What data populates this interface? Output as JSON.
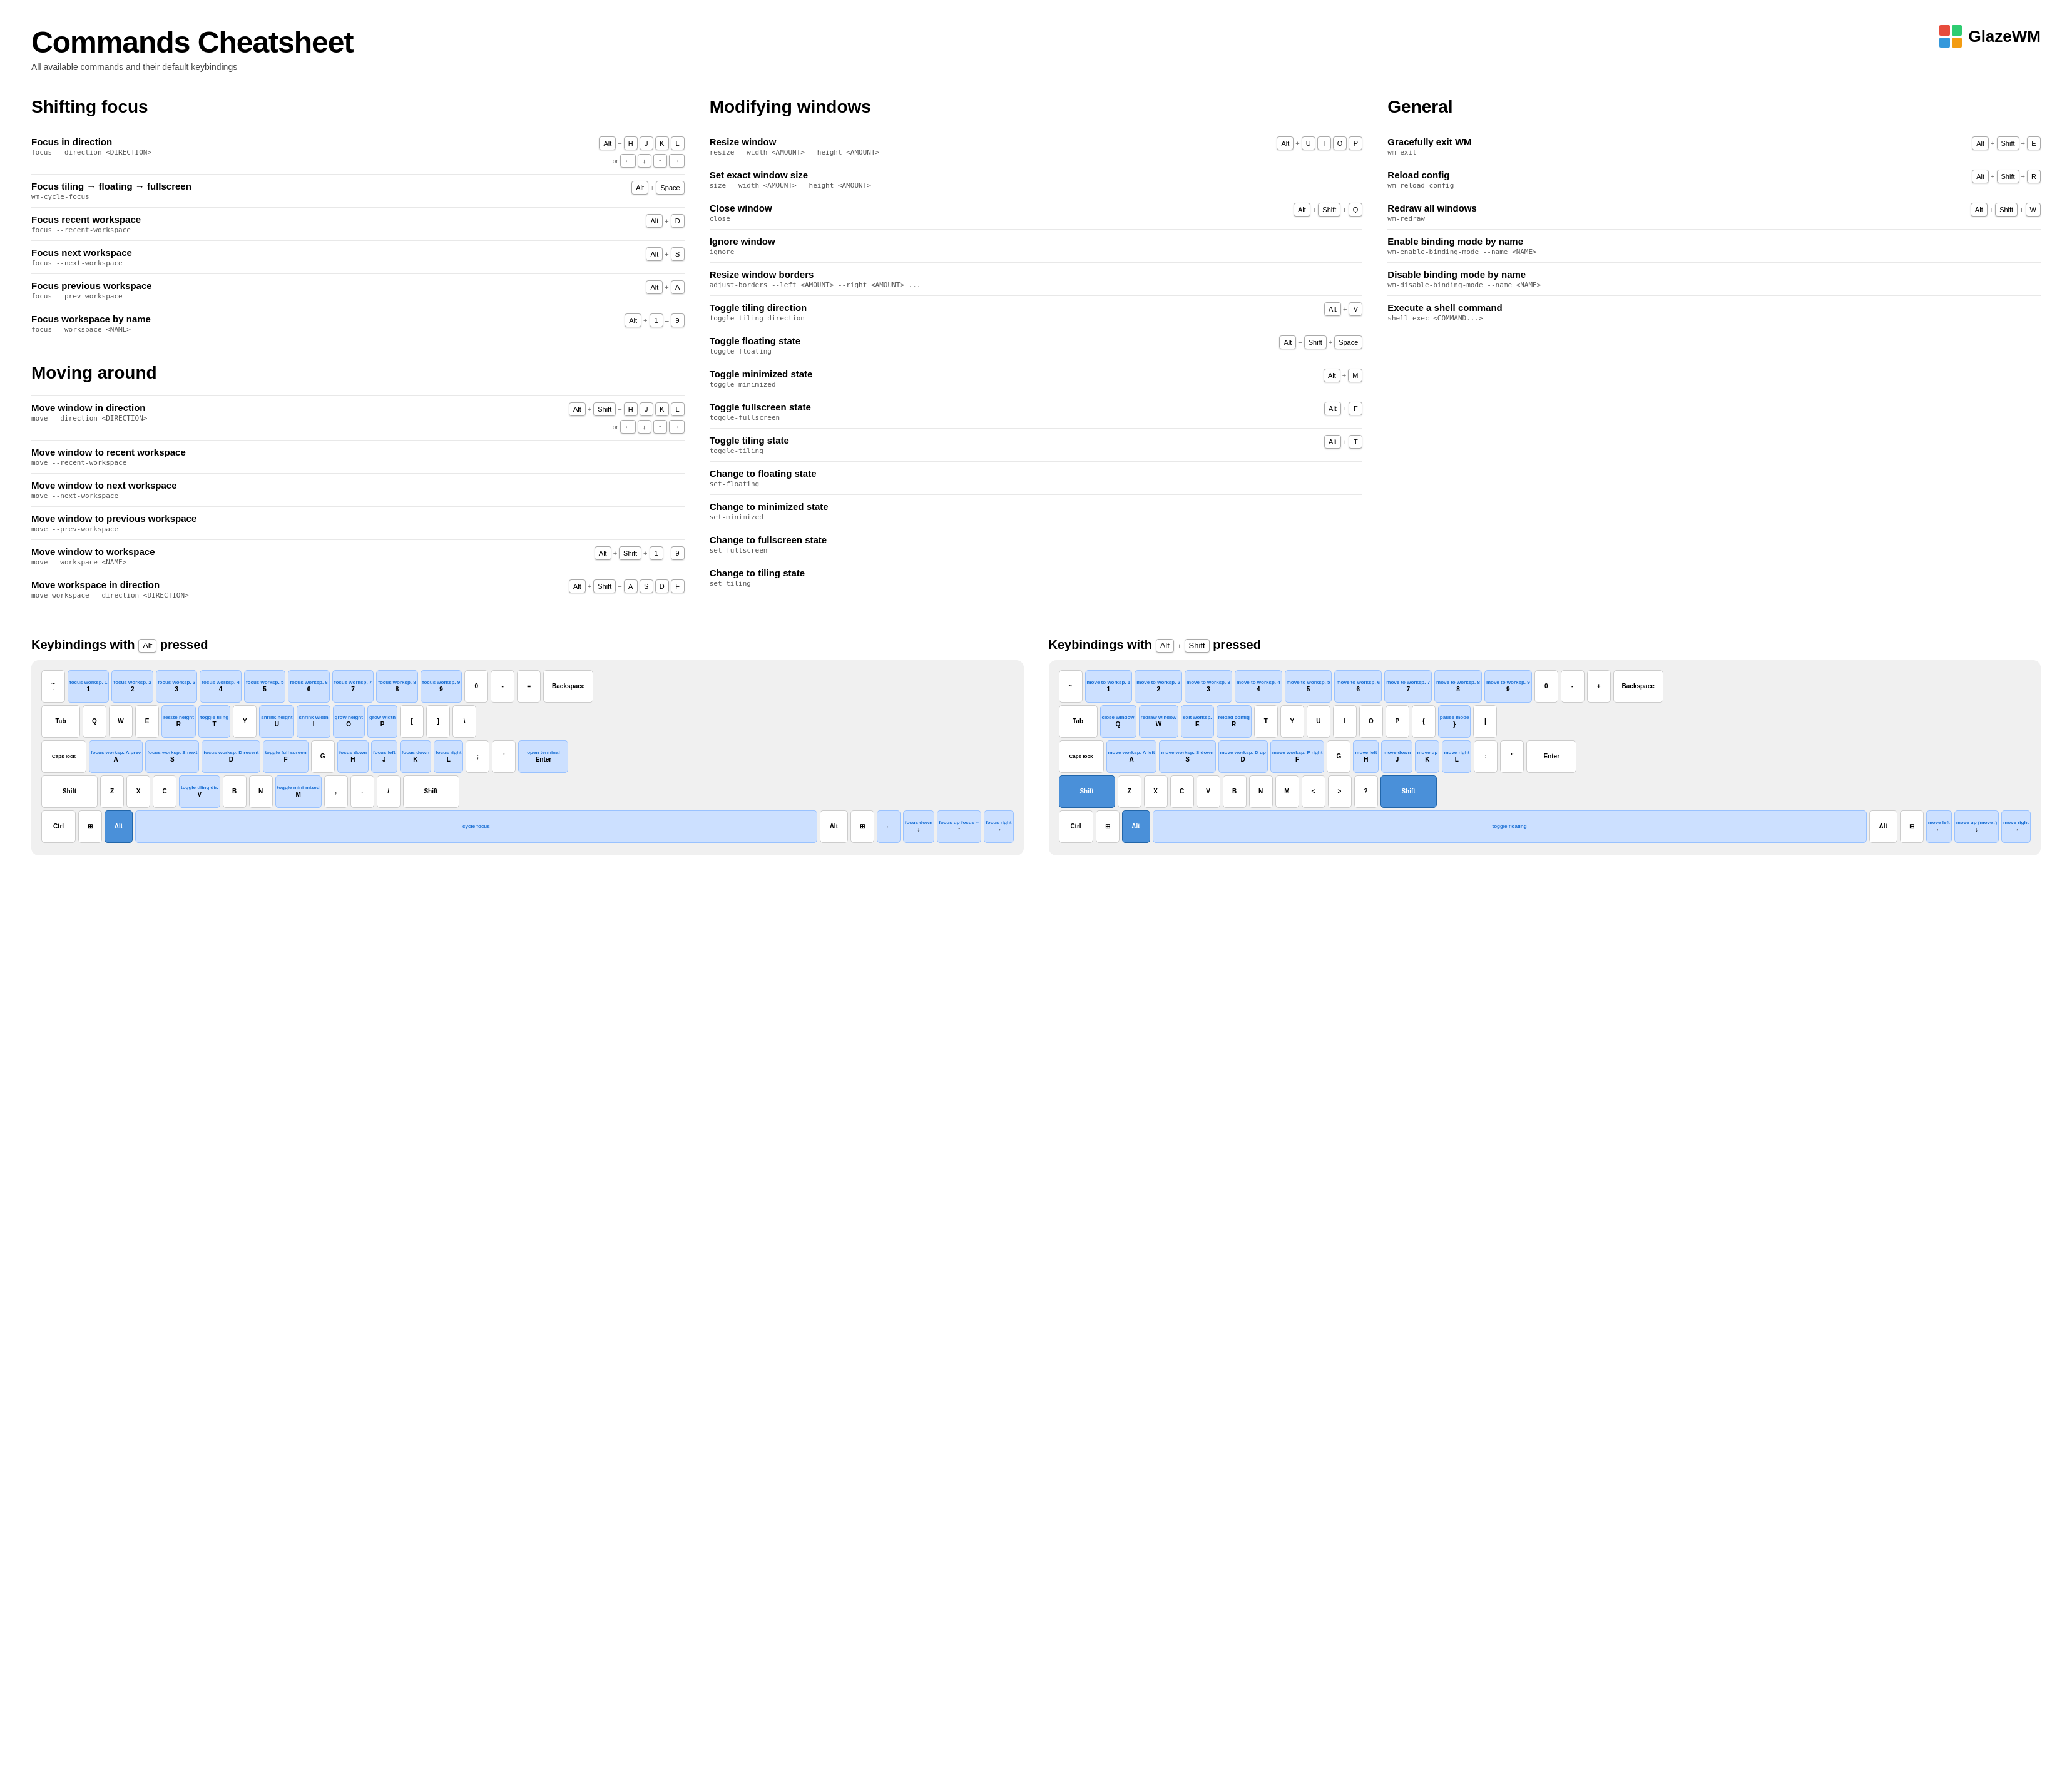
{
  "header": {
    "title": "Commands Cheatsheet",
    "subtitle": "All available commands and their default keybindings",
    "logo_text": "GlazeWM",
    "logo_colors": [
      "#e74c3c",
      "#2ecc71",
      "#3498db",
      "#f39c12"
    ]
  },
  "sections": {
    "shifting_focus": {
      "title": "Shifting focus",
      "commands": [
        {
          "name": "Focus in direction",
          "code": "focus --direction <DIRECTION>",
          "keys": [
            [
              "Alt",
              "H",
              "J",
              "K",
              "L"
            ],
            [
              "←",
              "↓",
              "↑",
              "→"
            ]
          ],
          "has_or": true
        },
        {
          "name": "Focus tiling → floating → fullscreen",
          "code": "wm-cycle-focus",
          "keys": [
            [
              "Alt",
              "Space"
            ]
          ]
        },
        {
          "name": "Focus recent workspace",
          "code": "focus --recent-workspace",
          "keys": [
            [
              "Alt",
              "D"
            ]
          ]
        },
        {
          "name": "Focus next workspace",
          "code": "focus --next-workspace",
          "keys": [
            [
              "Alt",
              "S"
            ]
          ]
        },
        {
          "name": "Focus previous workspace",
          "code": "focus --prev-workspace",
          "keys": [
            [
              "Alt",
              "A"
            ]
          ]
        },
        {
          "name": "Focus workspace by name",
          "code": "focus --workspace <NAME>",
          "keys": [
            [
              "Alt",
              "1",
              "–",
              "9"
            ]
          ]
        }
      ]
    },
    "moving_around": {
      "title": "Moving around",
      "commands": [
        {
          "name": "Move window in direction",
          "code": "move --direction <DIRECTION>",
          "keys": [
            [
              "Alt",
              "Shift",
              "H",
              "J",
              "K",
              "L"
            ],
            [
              "←",
              "↓",
              "↑",
              "→"
            ]
          ],
          "has_or": true
        },
        {
          "name": "Move window to recent workspace",
          "code": "move --recent-workspace",
          "keys": null
        },
        {
          "name": "Move window to next workspace",
          "code": "move --next-workspace",
          "keys": null
        },
        {
          "name": "Move window to previous workspace",
          "code": "move --prev-workspace",
          "keys": null
        },
        {
          "name": "Move window to workspace",
          "code": "move --workspace <NAME>",
          "keys": [
            [
              "Alt",
              "Shift",
              "1",
              "–",
              "9"
            ]
          ]
        },
        {
          "name": "Move workspace in direction",
          "code": "move-workspace --direction <DIRECTION>",
          "keys": [
            [
              "Alt",
              "Shift",
              "A",
              "S",
              "D",
              "F"
            ]
          ]
        }
      ]
    },
    "modifying_windows": {
      "title": "Modifying windows",
      "commands": [
        {
          "name": "Resize window",
          "code": "resize --width <AMOUNT> --height <AMOUNT>",
          "keys": [
            [
              "Alt",
              "U",
              "I",
              "O",
              "P"
            ]
          ]
        },
        {
          "name": "Set exact window size",
          "code": "size --width <AMOUNT> --height <AMOUNT>",
          "keys": null
        },
        {
          "name": "Close window",
          "code": "close",
          "keys": [
            [
              "Alt",
              "Shift",
              "Q"
            ]
          ]
        },
        {
          "name": "Ignore window",
          "code": "ignore",
          "keys": null
        },
        {
          "name": "Resize window borders",
          "code": "adjust-borders --left <AMOUNT> --right <AMOUNT> ...",
          "keys": null
        },
        {
          "name": "Toggle tiling direction",
          "code": "toggle-tiling-direction",
          "keys": [
            [
              "Alt",
              "V"
            ]
          ]
        },
        {
          "name": "Toggle floating state",
          "code": "toggle-floating",
          "keys": [
            [
              "Alt",
              "Shift",
              "Space"
            ]
          ]
        },
        {
          "name": "Toggle minimized state",
          "code": "toggle-minimized",
          "keys": [
            [
              "Alt",
              "M"
            ]
          ]
        },
        {
          "name": "Toggle fullscreen state",
          "code": "toggle-fullscreen",
          "keys": [
            [
              "Alt",
              "F"
            ]
          ]
        },
        {
          "name": "Toggle tiling state",
          "code": "toggle-tiling",
          "keys": [
            [
              "Alt",
              "T"
            ]
          ]
        },
        {
          "name": "Change to floating state",
          "code": "set-floating",
          "keys": null
        },
        {
          "name": "Change to minimized state",
          "code": "set-minimized",
          "keys": null
        },
        {
          "name": "Change to fullscreen state",
          "code": "set-fullscreen",
          "keys": null
        },
        {
          "name": "Change to tiling state",
          "code": "set-tiling",
          "keys": null
        }
      ]
    },
    "general": {
      "title": "General",
      "commands": [
        {
          "name": "Gracefully exit WM",
          "code": "wm-exit",
          "keys": [
            [
              "Alt",
              "Shift",
              "E"
            ]
          ]
        },
        {
          "name": "Reload config",
          "code": "wm-reload-config",
          "keys": [
            [
              "Alt",
              "Shift",
              "R"
            ]
          ]
        },
        {
          "name": "Redraw all windows",
          "code": "wm-redraw",
          "keys": [
            [
              "Alt",
              "Shift",
              "W"
            ]
          ]
        },
        {
          "name": "Enable binding mode by name",
          "code": "wm-enable-binding-mode --name <NAME>",
          "keys": null
        },
        {
          "name": "Disable binding mode by name",
          "code": "wm-disable-binding-mode --name <NAME>",
          "keys": null
        },
        {
          "name": "Execute a shell command",
          "code": "shell-exec <COMMAND...>",
          "keys": null
        }
      ]
    }
  },
  "keyboards": {
    "alt_pressed": {
      "title": "Keybindings with",
      "modifier": "Alt",
      "modifier_label": "pressed"
    },
    "alt_shift_pressed": {
      "title": "Keybindings with",
      "modifier": "Alt",
      "modifier2": "Shift",
      "modifier_label": "pressed"
    }
  }
}
